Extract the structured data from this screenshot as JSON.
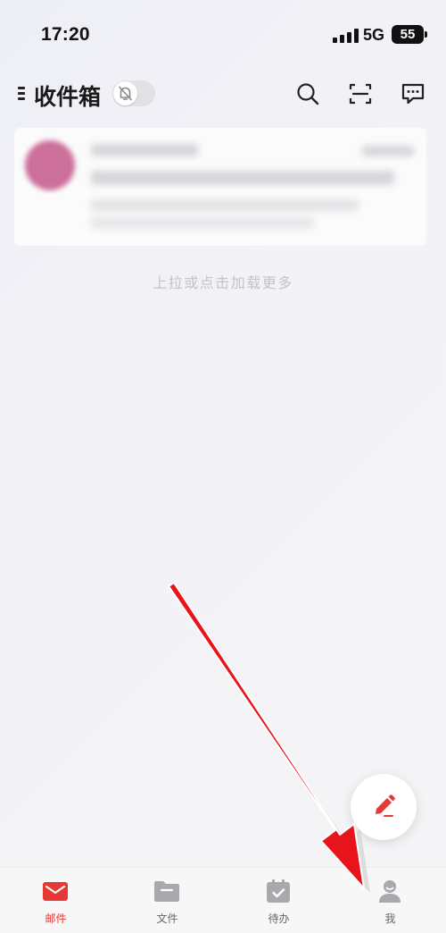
{
  "status_bar": {
    "time": "17:20",
    "network": "5G",
    "battery": "55"
  },
  "header": {
    "title": "收件箱",
    "icons": {
      "menu": "menu-icon",
      "mute": "bell-slash-icon",
      "search": "search-icon",
      "scan": "scan-icon",
      "chat": "chat-icon"
    }
  },
  "mail_list": {
    "load_more_text": "上拉或点击加载更多"
  },
  "fab": {
    "icon": "pencil-icon"
  },
  "tabbar": {
    "tabs": [
      {
        "label": "邮件",
        "icon": "mail-icon",
        "active": true
      },
      {
        "label": "文件",
        "icon": "folder-icon",
        "active": false
      },
      {
        "label": "待办",
        "icon": "calendar-check-icon",
        "active": false
      },
      {
        "label": "我",
        "icon": "profile-icon",
        "active": false
      }
    ]
  },
  "colors": {
    "accent": "#e53935",
    "annotation_arrow": "#e8141c",
    "inactive_icon": "#a9a9ad"
  }
}
